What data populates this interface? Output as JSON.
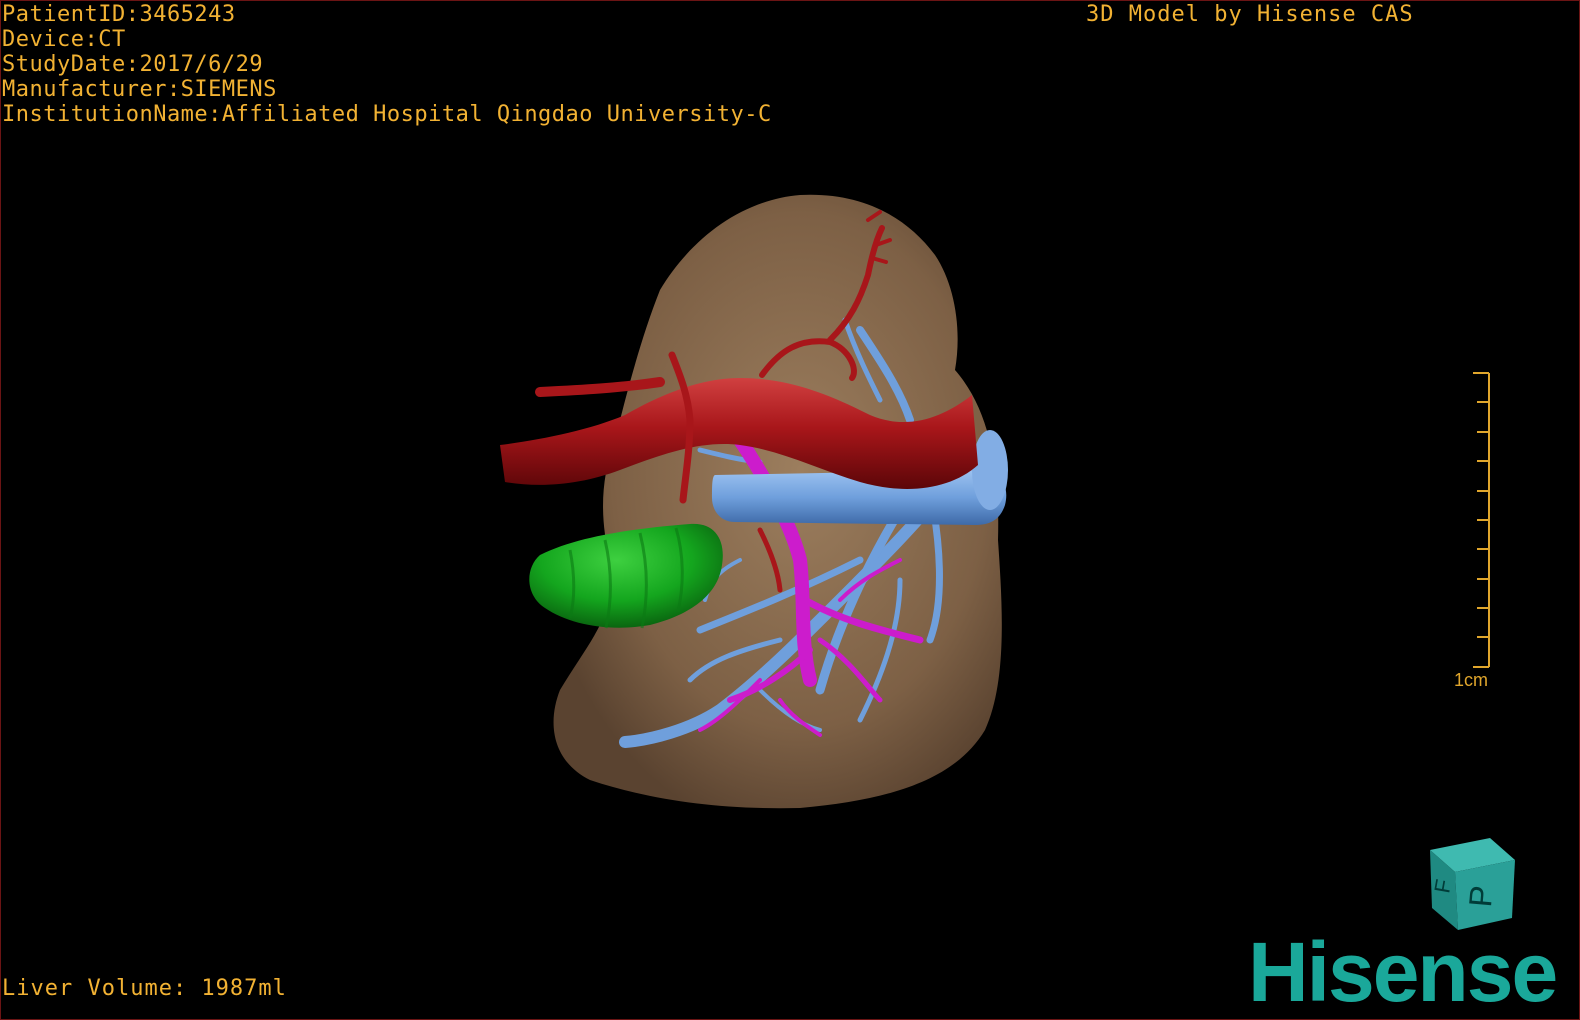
{
  "overlay": {
    "text_color": "#f2b233",
    "patient_id": "PatientID:3465243",
    "device": "Device:CT",
    "study_date": "StudyDate:2017/6/29",
    "manufacturer": "Manufacturer:SIEMENS",
    "institution": "InstitutionName:Affiliated Hospital Qingdao University-C",
    "credit": "3D Model by Hisense CAS",
    "liver_volume": "Liver Volume: 1987ml"
  },
  "scale_bar": {
    "label": "1cm",
    "color": "#e0a62c"
  },
  "orientation_cube": {
    "color": "#2aa098",
    "face_labels": [
      "F",
      "P"
    ]
  },
  "brand": {
    "logo_text": "Hisense",
    "logo_color": "#1aa89a"
  },
  "structures": {
    "liver": "#8a6c4e",
    "artery": "#a8161a",
    "portal_vein": "#6f9fdc",
    "hepatic_vein": "#cc1ccc",
    "gallbladder": "#14a61e"
  }
}
